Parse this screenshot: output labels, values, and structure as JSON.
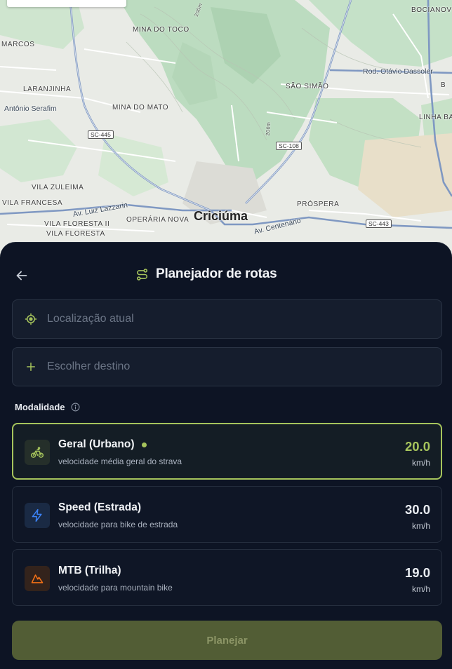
{
  "map": {
    "city": "Criciúma",
    "labels": {
      "bocianov": "BOCIANOV",
      "mina_do_toco": "MINA DO TOCO",
      "marcos": "MARCOS",
      "rod_otavio": "Rod. Otávio Dassoler",
      "laranjinha": "LARANJINHA",
      "sao_simao": "SÃO SIMÃO",
      "antonio_serafim": "Antônio Serafim",
      "mina_do_mato": "MINA DO MATO",
      "linha_ba": "LINHA BA",
      "vila_zuleima": "VILA ZULEIMA",
      "vila_francesa": "VILA FRANCESA",
      "av_luiz": "Av. Luiz Lazzarin",
      "prospera": "PRÓSPERA",
      "vila_floresta_ii": "VILA FLORESTA II",
      "vila_floresta": "VILA FLORESTA",
      "operaria_nova": "OPERÁRIA NOVA",
      "av_centenario": "Av. Centenário",
      "elev_200m_a": "200m",
      "elev_200m_b": "200m",
      "edge_b": "B"
    },
    "shields": {
      "sc445": "SC-445",
      "sc108": "SC-108",
      "sc443": "SC-443"
    }
  },
  "panel": {
    "title": "Planejador de rotas",
    "back_icon": "arrow-left-icon",
    "title_icon": "route-icon",
    "origin": {
      "placeholder": "Localização atual",
      "icon": "crosshair-icon"
    },
    "destination": {
      "placeholder": "Escolher destino",
      "icon": "plus-icon"
    },
    "modality_label": "Modalidade",
    "modes": [
      {
        "name": "Geral (Urbano)",
        "description": "velocidade média geral do strava",
        "speed": "20.0",
        "unit": "km/h",
        "icon": "bike-icon",
        "selected": true,
        "accent": "#a6c45c"
      },
      {
        "name": "Speed (Estrada)",
        "description": "velocidade para bike de estrada",
        "speed": "30.0",
        "unit": "km/h",
        "icon": "lightning-icon",
        "selected": false,
        "accent": "#3b82f6"
      },
      {
        "name": "MTB (Trilha)",
        "description": "velocidade para mountain bike",
        "speed": "19.0",
        "unit": "km/h",
        "icon": "mountain-icon",
        "selected": false,
        "accent": "#f97316"
      }
    ],
    "plan_button": "Planejar"
  },
  "colors": {
    "accent": "#a6c45c",
    "panel_bg": "#0d1424",
    "button_bg": "#525d35"
  }
}
